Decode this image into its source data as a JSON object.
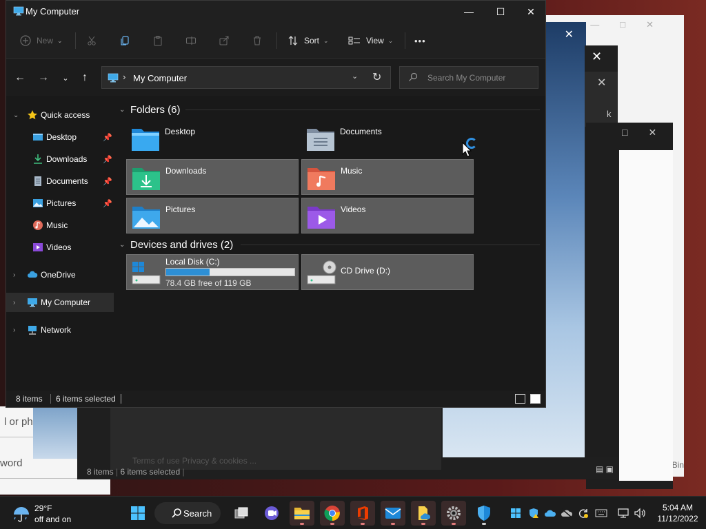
{
  "window": {
    "title": "My Computer"
  },
  "toolbar": {
    "new_label": "New",
    "sort_label": "Sort",
    "view_label": "View",
    "more_label": "•••"
  },
  "address": {
    "location": "My Computer"
  },
  "search": {
    "placeholder": "Search My Computer"
  },
  "sidebar": {
    "quick_access": "Quick access",
    "items": [
      {
        "label": "Desktop"
      },
      {
        "label": "Downloads"
      },
      {
        "label": "Documents"
      },
      {
        "label": "Pictures"
      },
      {
        "label": "Music"
      },
      {
        "label": "Videos"
      }
    ],
    "onedrive": "OneDrive",
    "my_computer": "My Computer",
    "network": "Network"
  },
  "content": {
    "folders_header": "Folders (6)",
    "folders": [
      {
        "name": "Desktop"
      },
      {
        "name": "Documents"
      },
      {
        "name": "Downloads"
      },
      {
        "name": "Music"
      },
      {
        "name": "Pictures"
      },
      {
        "name": "Videos"
      }
    ],
    "devices_header": "Devices and drives (2)",
    "drives": [
      {
        "name": "Local Disk (C:)",
        "free_text": "78.4 GB free of 119 GB",
        "used_fraction": 0.34
      },
      {
        "name": "CD Drive (D:)"
      }
    ]
  },
  "status": {
    "items": "8 items",
    "selected": "6 items selected"
  },
  "background": {
    "or_phone": "l or pho",
    "word": "word",
    "footer": "Terms of use   Privacy & cookies   ...",
    "items": "8 items",
    "selected": "6 items selected",
    "bin": "Bin",
    "k": "k"
  },
  "taskbar": {
    "temp": "29°F",
    "weather_desc": "off and on",
    "search_label": "Search",
    "time": "5:04 AM",
    "date": "11/12/2022"
  },
  "colors": {
    "accent": "#2d8fd5",
    "window_bg": "#191919",
    "selected_tile": "#5c5c5c"
  }
}
